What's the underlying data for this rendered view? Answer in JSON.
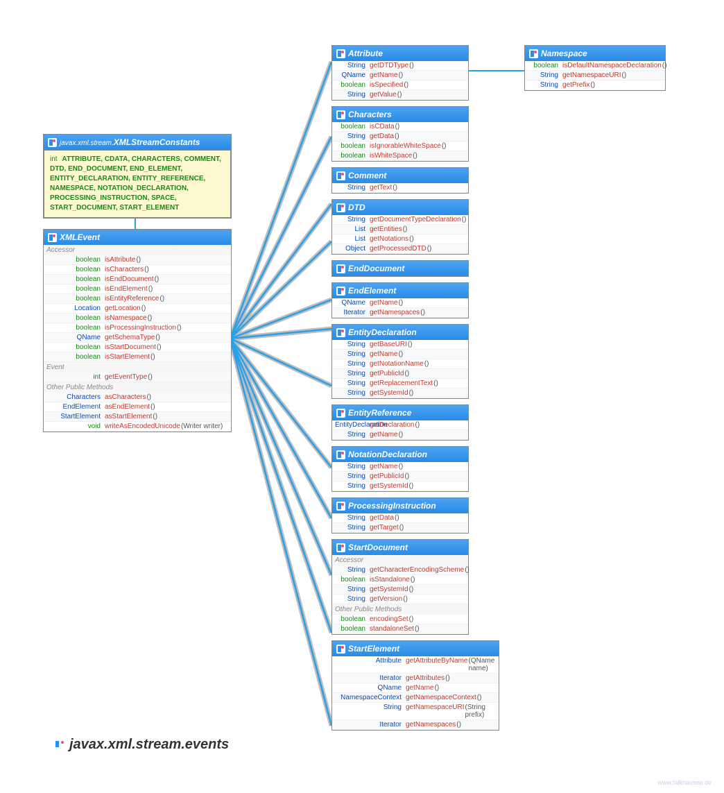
{
  "constants": {
    "pkg": "javax.xml.stream.",
    "name": "XMLStreamConstants",
    "type": "int",
    "values": "ATTRIBUTE, CDATA, CHARACTERS, COMMENT, DTD, END_DOCUMENT, END_ELEMENT, ENTITY_DECLARATION, ENTITY_REFERENCE, NAMESPACE, NOTATION_DECLARATION, PROCESSING_INSTRUCTION, SPACE, START_DOCUMENT, START_ELEMENT"
  },
  "xmlevent": {
    "name": "XMLEvent",
    "sections": [
      {
        "label": "Accessor",
        "rows": [
          {
            "t": "boolean",
            "m": "isAttribute",
            "p": "()"
          },
          {
            "t": "boolean",
            "m": "isCharacters",
            "p": "()"
          },
          {
            "t": "boolean",
            "m": "isEndDocument",
            "p": "()"
          },
          {
            "t": "boolean",
            "m": "isEndElement",
            "p": "()"
          },
          {
            "t": "boolean",
            "m": "isEntityReference",
            "p": "()"
          },
          {
            "t": "Location",
            "m": "getLocation",
            "p": "()"
          },
          {
            "t": "boolean",
            "m": "isNamespace",
            "p": "()"
          },
          {
            "t": "boolean",
            "m": "isProcessingInstruction",
            "p": "()"
          },
          {
            "t": "QName",
            "m": "getSchemaType",
            "p": "()"
          },
          {
            "t": "boolean",
            "m": "isStartDocument",
            "p": "()"
          },
          {
            "t": "boolean",
            "m": "isStartElement",
            "p": "()"
          }
        ]
      },
      {
        "label": "Event",
        "rows": [
          {
            "t": "int",
            "m": "getEventType",
            "p": "()"
          }
        ]
      },
      {
        "label": "Other Public Methods",
        "rows": [
          {
            "t": "Characters",
            "m": "asCharacters",
            "p": "()"
          },
          {
            "t": "EndElement",
            "m": "asEndElement",
            "p": "()"
          },
          {
            "t": "StartElement",
            "m": "asStartElement",
            "p": "()"
          },
          {
            "t": "void",
            "m": "writeAsEncodedUnicode",
            "p": "(Writer writer)"
          }
        ]
      }
    ]
  },
  "right": [
    {
      "name": "Attribute",
      "rows": [
        {
          "t": "String",
          "m": "getDTDType",
          "p": "()"
        },
        {
          "t": "QName",
          "m": "getName",
          "p": "()"
        },
        {
          "t": "boolean",
          "m": "isSpecified",
          "p": "()"
        },
        {
          "t": "String",
          "m": "getValue",
          "p": "()"
        }
      ]
    },
    {
      "name": "Characters",
      "rows": [
        {
          "t": "boolean",
          "m": "isCData",
          "p": "()"
        },
        {
          "t": "String",
          "m": "getData",
          "p": "()"
        },
        {
          "t": "boolean",
          "m": "isIgnorableWhiteSpace",
          "p": "()"
        },
        {
          "t": "boolean",
          "m": "isWhiteSpace",
          "p": "()"
        }
      ]
    },
    {
      "name": "Comment",
      "rows": [
        {
          "t": "String",
          "m": "getText",
          "p": "()"
        }
      ]
    },
    {
      "name": "DTD",
      "rows": [
        {
          "t": "String",
          "m": "getDocumentTypeDeclaration",
          "p": "()"
        },
        {
          "t": "List",
          "m": "getEntities",
          "p": "()"
        },
        {
          "t": "List",
          "m": "getNotations",
          "p": "()"
        },
        {
          "t": "Object",
          "m": "getProcessedDTD",
          "p": "()"
        }
      ]
    },
    {
      "name": "EndDocument",
      "rows": []
    },
    {
      "name": "EndElement",
      "rows": [
        {
          "t": "QName",
          "m": "getName",
          "p": "()"
        },
        {
          "t": "Iterator",
          "m": "getNamespaces",
          "p": "()"
        }
      ]
    },
    {
      "name": "EntityDeclaration",
      "rows": [
        {
          "t": "String",
          "m": "getBaseURI",
          "p": "()"
        },
        {
          "t": "String",
          "m": "getName",
          "p": "()"
        },
        {
          "t": "String",
          "m": "getNotationName",
          "p": "()"
        },
        {
          "t": "String",
          "m": "getPublicId",
          "p": "()"
        },
        {
          "t": "String",
          "m": "getReplacementText",
          "p": "()"
        },
        {
          "t": "String",
          "m": "getSystemId",
          "p": "()"
        }
      ]
    },
    {
      "name": "EntityReference",
      "rows": [
        {
          "t": "EntityDeclaration",
          "m": "getDeclaration",
          "p": "()"
        },
        {
          "t": "String",
          "m": "getName",
          "p": "()"
        }
      ]
    },
    {
      "name": "NotationDeclaration",
      "rows": [
        {
          "t": "String",
          "m": "getName",
          "p": "()"
        },
        {
          "t": "String",
          "m": "getPublicId",
          "p": "()"
        },
        {
          "t": "String",
          "m": "getSystemId",
          "p": "()"
        }
      ]
    },
    {
      "name": "ProcessingInstruction",
      "rows": [
        {
          "t": "String",
          "m": "getData",
          "p": "()"
        },
        {
          "t": "String",
          "m": "getTarget",
          "p": "()"
        }
      ]
    },
    {
      "name": "StartDocument",
      "sections": [
        {
          "label": "Accessor",
          "rows": [
            {
              "t": "String",
              "m": "getCharacterEncodingScheme",
              "p": "()"
            },
            {
              "t": "boolean",
              "m": "isStandalone",
              "p": "()"
            },
            {
              "t": "String",
              "m": "getSystemId",
              "p": "()"
            },
            {
              "t": "String",
              "m": "getVersion",
              "p": "()"
            }
          ]
        },
        {
          "label": "Other Public Methods",
          "rows": [
            {
              "t": "boolean",
              "m": "encodingSet",
              "p": "()"
            },
            {
              "t": "boolean",
              "m": "standaloneSet",
              "p": "()"
            }
          ]
        }
      ]
    },
    {
      "name": "StartElement",
      "wide": true,
      "rows": [
        {
          "t": "Attribute",
          "m": "getAttributeByName",
          "p": "(QName name)"
        },
        {
          "t": "Iterator",
          "m": "getAttributes",
          "p": "()"
        },
        {
          "t": "QName",
          "m": "getName",
          "p": "()"
        },
        {
          "t": "NamespaceContext",
          "m": "getNamespaceContext",
          "p": "()"
        },
        {
          "t": "String",
          "m": "getNamespaceURI",
          "p": "(String prefix)"
        },
        {
          "t": "Iterator",
          "m": "getNamespaces",
          "p": "()"
        }
      ]
    }
  ],
  "namespace": {
    "name": "Namespace",
    "rows": [
      {
        "t": "boolean",
        "m": "isDefaultNamespaceDeclaration",
        "p": "()"
      },
      {
        "t": "String",
        "m": "getNamespaceURI",
        "p": "()"
      },
      {
        "t": "String",
        "m": "getPrefix",
        "p": "()"
      }
    ]
  },
  "packageTitle": "javax.xml.stream.events",
  "watermark": "www.falkhausen.de"
}
